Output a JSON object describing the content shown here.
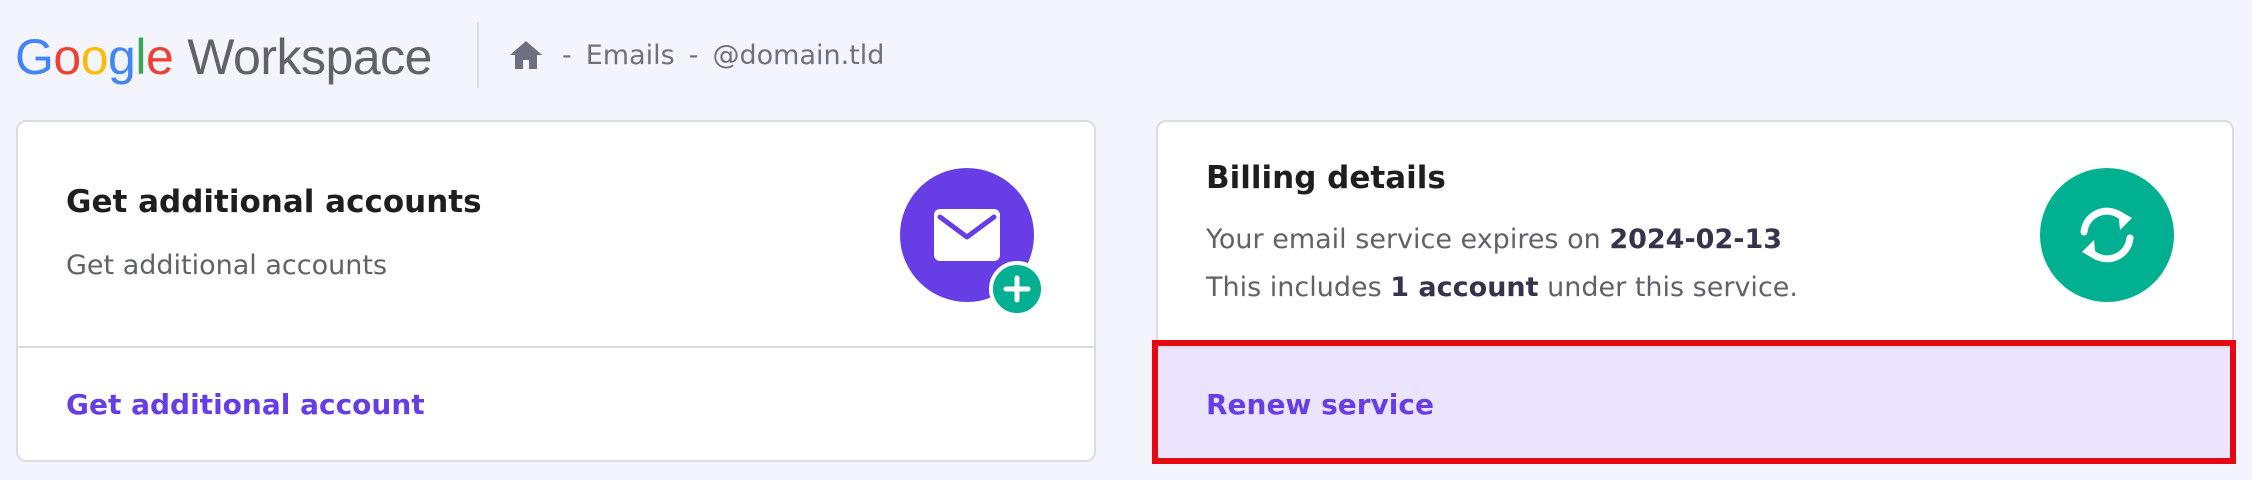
{
  "header": {
    "logo": {
      "g1": "G",
      "o1": "o",
      "o2": "o",
      "g2": "g",
      "l": "l",
      "e": "e",
      "product": "Workspace"
    },
    "breadcrumb": {
      "separator1": "-",
      "item1": "Emails",
      "separator2": "-",
      "item2": "@domain.tld"
    }
  },
  "cards": {
    "additional": {
      "title": "Get additional accounts",
      "description": "Get additional accounts",
      "action": "Get additional account"
    },
    "billing": {
      "title": "Billing details",
      "expires_prefix": "Your email service expires on",
      "expires_date": "2024-02-13",
      "includes_prefix": "This includes",
      "includes_count": "1 account",
      "includes_suffix": "under this service.",
      "action": "Renew service"
    }
  },
  "icons": {
    "home": "home-icon",
    "mail": "envelope-icon",
    "plus": "plus-icon",
    "sync": "sync-icon"
  },
  "colors": {
    "brand_purple": "#673de6",
    "brand_green": "#00b090",
    "highlight_red": "#e50914",
    "renew_bg": "#ebe4ff"
  }
}
